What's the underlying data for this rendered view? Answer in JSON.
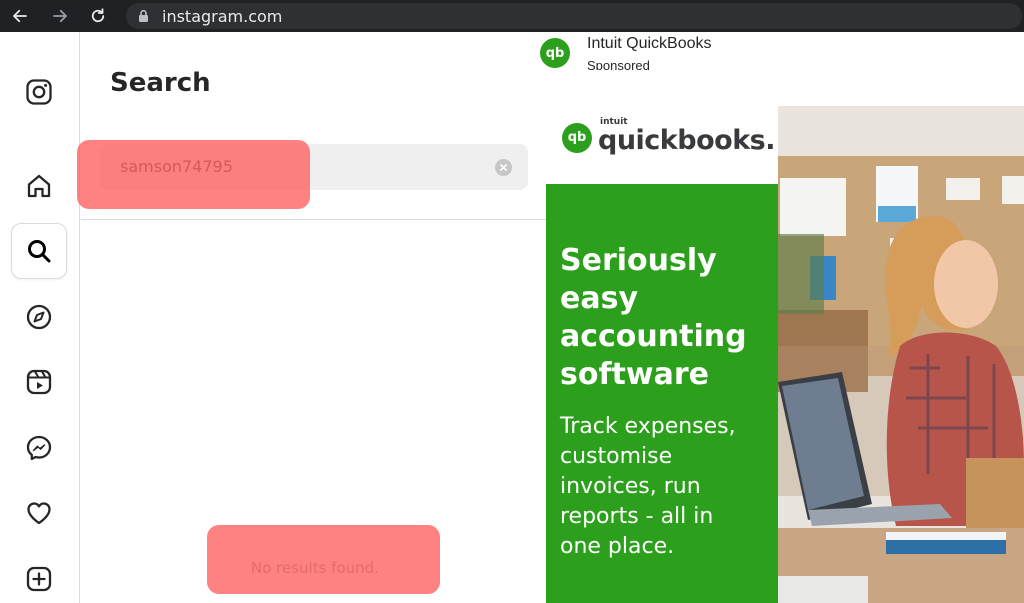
{
  "browser": {
    "url": "instagram.com"
  },
  "sidebar": {
    "items": [
      {
        "name": "instagram-logo-icon"
      },
      {
        "name": "home-icon"
      },
      {
        "name": "search-icon",
        "active": true
      },
      {
        "name": "explore-icon"
      },
      {
        "name": "reels-icon"
      },
      {
        "name": "messenger-icon"
      },
      {
        "name": "heart-icon"
      },
      {
        "name": "create-icon"
      }
    ]
  },
  "search": {
    "title": "Search",
    "query": "samson74795",
    "no_results": "No results found."
  },
  "ad": {
    "advertiser": "Intuit QuickBooks",
    "sponsored": "Sponsored",
    "logo_badge": "qb",
    "brand_top": "intuit",
    "brand_name": "quickbooks.",
    "headline_lines": [
      "Seriously",
      "easy",
      "accounting",
      "software"
    ],
    "body_lines": [
      "Track expenses,",
      "customise",
      "invoices, run",
      "reports - all in",
      "one place."
    ],
    "brand_color": "#2ca01c"
  },
  "highlight_color": "#ff5f5f"
}
